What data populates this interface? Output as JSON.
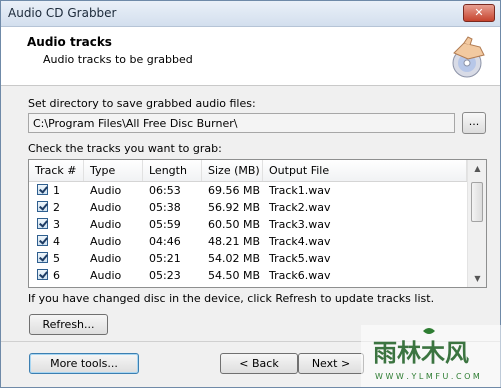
{
  "window": {
    "title": "Audio CD Grabber",
    "close_label": "✕"
  },
  "header": {
    "title": "Audio tracks",
    "subtitle": "Audio tracks to be grabbed"
  },
  "directory": {
    "label": "Set directory to save grabbed audio files:",
    "value": "C:\\Program Files\\All Free Disc Burner\\",
    "browse_label": "..."
  },
  "tracks": {
    "label": "Check the tracks you want to grab:",
    "columns": [
      "Track #",
      "Type",
      "Length",
      "Size (MB)",
      "Output File"
    ],
    "rows": [
      {
        "track": "1",
        "type": "Audio",
        "length": "06:53",
        "size": "69.56 MB",
        "file": "Track1.wav",
        "checked": true
      },
      {
        "track": "2",
        "type": "Audio",
        "length": "05:38",
        "size": "56.92 MB",
        "file": "Track2.wav",
        "checked": true
      },
      {
        "track": "3",
        "type": "Audio",
        "length": "05:59",
        "size": "60.50 MB",
        "file": "Track3.wav",
        "checked": true
      },
      {
        "track": "4",
        "type": "Audio",
        "length": "04:46",
        "size": "48.21 MB",
        "file": "Track4.wav",
        "checked": true
      },
      {
        "track": "5",
        "type": "Audio",
        "length": "05:21",
        "size": "54.02 MB",
        "file": "Track5.wav",
        "checked": true
      },
      {
        "track": "6",
        "type": "Audio",
        "length": "05:23",
        "size": "54.50 MB",
        "file": "Track6.wav",
        "checked": true
      }
    ]
  },
  "hint": "If you have changed disc in the device, click Refresh to update tracks list.",
  "buttons": {
    "refresh": "Refresh...",
    "more_tools": "More tools...",
    "back": "< Back",
    "next": "Next >"
  },
  "watermark": {
    "text": "雨林木风",
    "subtext": "W W W . Y L M F U . C O M"
  }
}
